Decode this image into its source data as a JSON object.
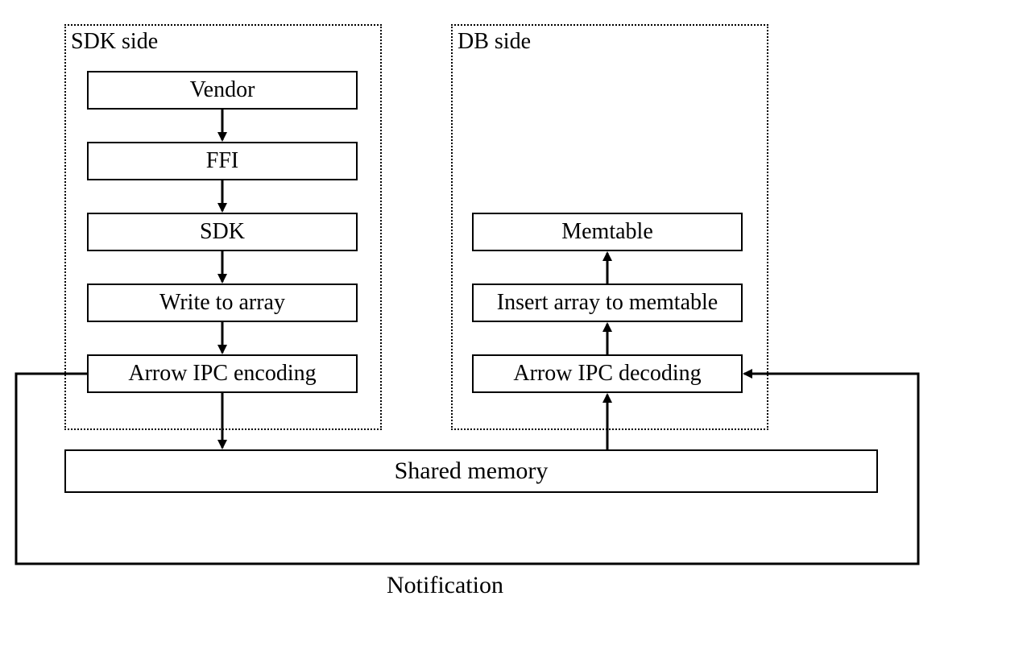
{
  "groups": {
    "sdk": {
      "title": "SDK side"
    },
    "db": {
      "title": "DB side"
    }
  },
  "sdk_steps": {
    "vendor": "Vendor",
    "ffi": "FFI",
    "sdk": "SDK",
    "write_to_array": "Write to array",
    "arrow_encode": "Arrow IPC encoding"
  },
  "db_steps": {
    "memtable": "Memtable",
    "insert_array": "Insert array to memtable",
    "arrow_decode": "Arrow IPC decoding"
  },
  "shared_memory": "Shared memory",
  "notification": "Notification"
}
